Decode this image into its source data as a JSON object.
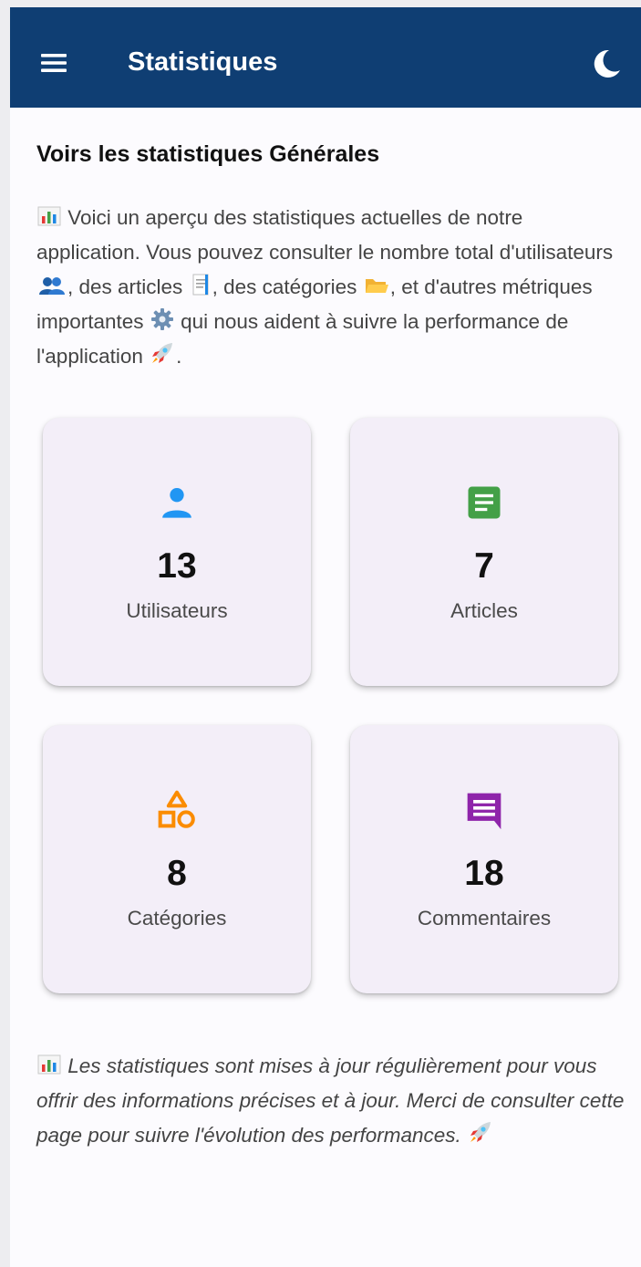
{
  "app_bar": {
    "title": "Statistiques",
    "menu_icon": "menu-icon",
    "theme_icon": "moon-icon",
    "background_color": "#0f3e73"
  },
  "intro": {
    "heading": "Voirs les statistiques Générales",
    "text_1": "Voici un aperçu des statistiques actuelles de notre application. Vous pouvez consulter le nombre total d'utilisateurs",
    "text_2": ", des articles",
    "text_3": ", des catégories",
    "text_4": ", et d'autres métriques importantes",
    "text_5": "qui nous aident à suivre la performance de l'application",
    "text_6": "."
  },
  "stats": [
    {
      "value": "13",
      "label": "Utilisateurs",
      "icon": "person-icon",
      "color": "#2196f3"
    },
    {
      "value": "7",
      "label": "Articles",
      "icon": "article-icon",
      "color": "#43a047"
    },
    {
      "value": "8",
      "label": "Catégories",
      "icon": "category-icon",
      "color": "#fb8c00"
    },
    {
      "value": "18",
      "label": "Commentaires",
      "icon": "comment-icon",
      "color": "#8e24aa"
    }
  ],
  "footer": {
    "text": "Les statistiques sont mises à jour régulièrement pour vous offrir des informations précises et à jour. Merci de consulter cette page pour suivre l'évolution des performances."
  }
}
